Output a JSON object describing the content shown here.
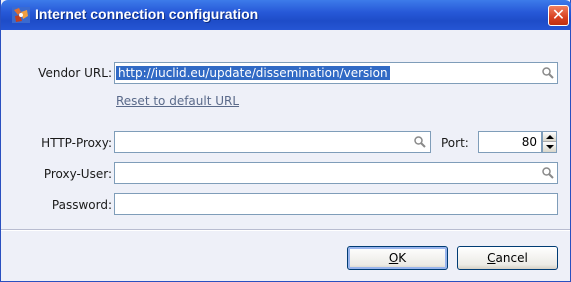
{
  "window": {
    "title": "Internet connection configuration",
    "close_glyph": "✕"
  },
  "vendor": {
    "label": "Vendor URL:",
    "value": "http://iuclid.eu/update/dissemination/version",
    "reset_link": "Reset to default URL"
  },
  "proxy": {
    "label": "HTTP-Proxy:",
    "value": "",
    "port_label": "Port:",
    "port_value": "80"
  },
  "proxy_user": {
    "label": "Proxy-User:",
    "value": ""
  },
  "password": {
    "label": "Password:",
    "value": ""
  },
  "buttons": {
    "ok_mnemonic": "O",
    "ok_rest": "K",
    "cancel_mnemonic": "C",
    "cancel_rest": "ancel"
  },
  "colors": {
    "titlebar": "#2759d8",
    "selection": "#316ac5",
    "close": "#d84020"
  },
  "icons": [
    "app-icon",
    "close-icon",
    "search-icon",
    "spinner-up-icon",
    "spinner-down-icon"
  ]
}
